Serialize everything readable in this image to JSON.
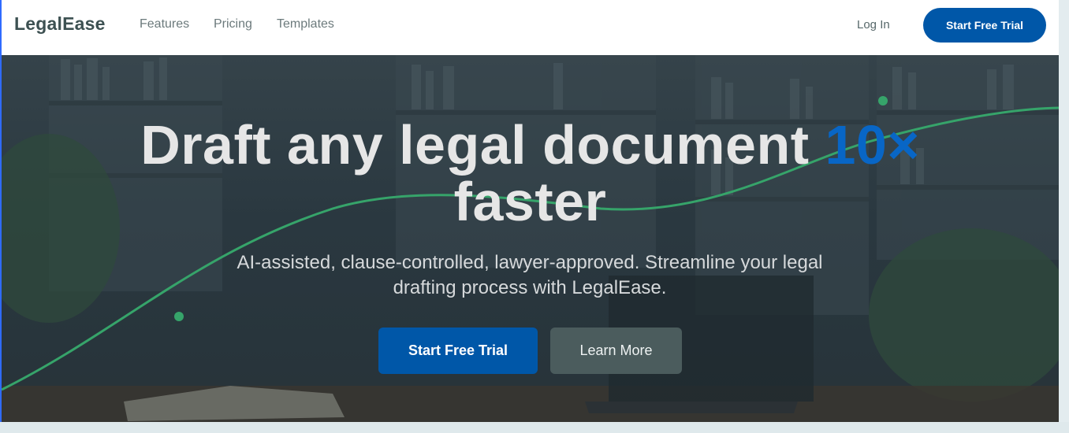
{
  "brand": {
    "name": "LegalEase"
  },
  "nav": {
    "items": [
      {
        "label": "Features"
      },
      {
        "label": "Pricing"
      },
      {
        "label": "Templates"
      }
    ],
    "login_label": "Log In",
    "cta_label": "Start Free Trial"
  },
  "hero": {
    "title_part1": "Draft any legal document ",
    "title_accent": "10×",
    "title_part2": "faster",
    "subtitle": "AI-assisted, clause-controlled, lawyer-approved. Streamline your legal drafting process with LegalEase.",
    "primary_button": "Start Free Trial",
    "secondary_button": "Learn More"
  },
  "colors": {
    "brand_blue": "#0057a8",
    "accent_blue": "#0866c6",
    "curve_green": "#36a46a",
    "secondary_button": "#4b5c5d"
  }
}
